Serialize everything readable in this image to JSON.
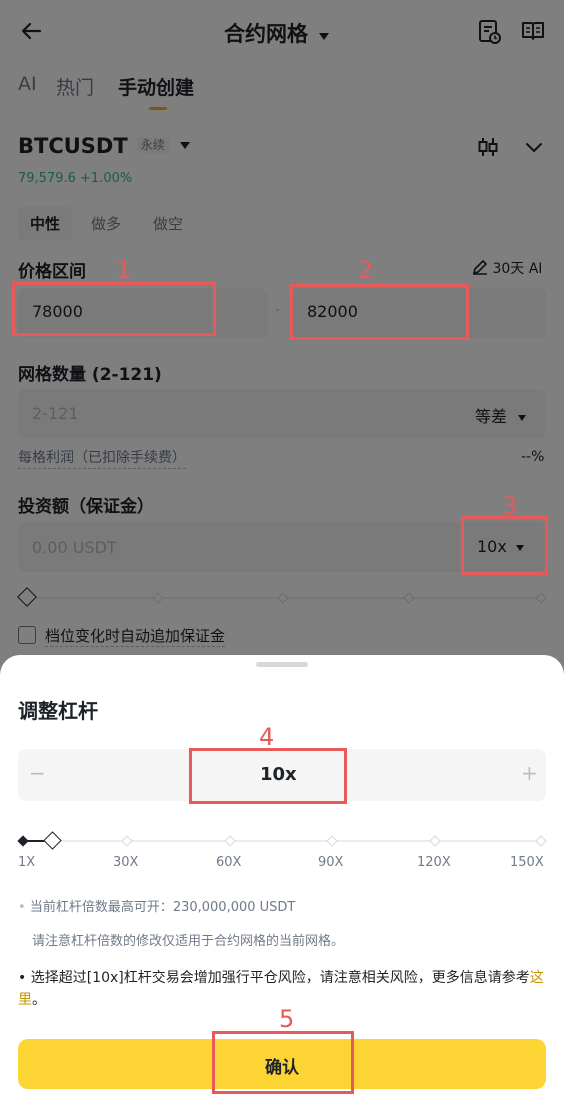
{
  "header": {
    "title": "合约网格",
    "back_icon": "arrow-left-icon",
    "history_icon": "document-clock-icon",
    "guide_icon": "book-icon"
  },
  "tabs": [
    {
      "label": "AI",
      "active": false
    },
    {
      "label": "热门",
      "active": false
    },
    {
      "label": "手动创建",
      "active": true
    }
  ],
  "symbol": {
    "name": "BTCUSDT",
    "badge": "永续",
    "price": "79,579.6",
    "change": "+1.00%",
    "change_color": "#2ebd85"
  },
  "modes": [
    {
      "label": "中性",
      "active": true
    },
    {
      "label": "做多",
      "active": false
    },
    {
      "label": "做空",
      "active": false
    }
  ],
  "price_range": {
    "label": "价格区间",
    "ai_label": "30天 AI",
    "low_value": "78000",
    "high_value": "82000",
    "separator": "-"
  },
  "grid_count": {
    "label": "网格数量 (2-121)",
    "placeholder": "2-121",
    "mode": "等差",
    "profit_label": "每格利润（已扣除手续费）",
    "profit_value": "--%"
  },
  "investment": {
    "label": "投资额（保证金）",
    "placeholder": "0.00 USDT",
    "leverage": "10x"
  },
  "auto_margin": {
    "label": "档位变化时自动追加保证金"
  },
  "sheet": {
    "title": "调整杠杆",
    "minus": "−",
    "plus": "+",
    "value": "10x",
    "leverage_fraction": 0.06,
    "ticks": [
      "1X",
      "30X",
      "60X",
      "90X",
      "120X",
      "150X"
    ],
    "note1": "当前杠杆倍数最高可开：230,000,000 USDT",
    "note2": "请注意杠杆倍数的修改仅适用于合约网格的当前网格。",
    "warning_main": "选择超过[10x]杠杆交易会增加强行平仓风险，请注意相关风险，更多信息请参考",
    "warning_link": "这里",
    "warning_end": "。",
    "confirm": "确认"
  },
  "annotations": {
    "n1": "1",
    "n2": "2",
    "n3": "3",
    "n4": "4",
    "n5": "5",
    "color": "#e85a5a"
  },
  "colors": {
    "accent": "#fcd535",
    "link": "#c99400",
    "positive": "#2ebd85"
  }
}
